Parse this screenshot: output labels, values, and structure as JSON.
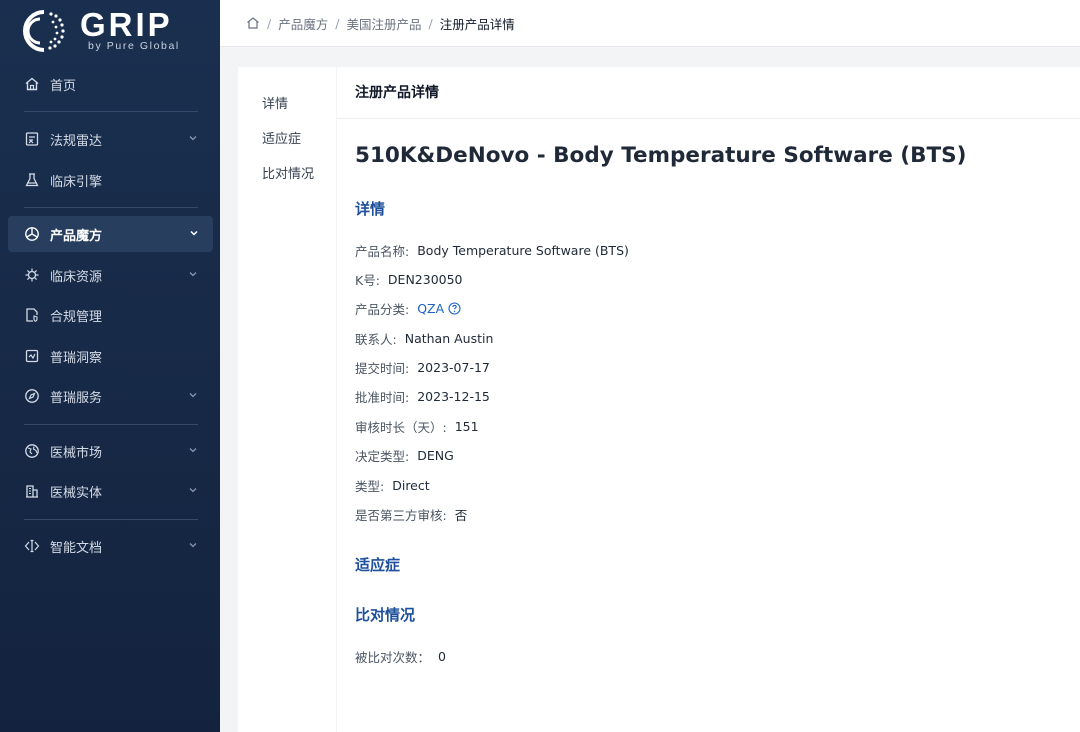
{
  "brand": {
    "name": "GRIP",
    "subtitle": "by Pure Global"
  },
  "sidebar": {
    "items": [
      {
        "label": "首页",
        "icon": "home-icon",
        "expandable": false
      },
      {
        "label": "法规雷达",
        "icon": "regulation-icon",
        "expandable": true
      },
      {
        "label": "临床引擎",
        "icon": "flask-icon",
        "expandable": false
      },
      {
        "label": "产品魔方",
        "icon": "cube-icon",
        "expandable": true,
        "active": true
      },
      {
        "label": "临床资源",
        "icon": "virus-icon",
        "expandable": true
      },
      {
        "label": "合规管理",
        "icon": "document-shield-icon",
        "expandable": false
      },
      {
        "label": "普瑞洞察",
        "icon": "insight-icon",
        "expandable": false
      },
      {
        "label": "普瑞服务",
        "icon": "compass-icon",
        "expandable": true
      },
      {
        "label": "医械市场",
        "icon": "globe-icon",
        "expandable": true
      },
      {
        "label": "医械实体",
        "icon": "building-icon",
        "expandable": true
      },
      {
        "label": "智能文档",
        "icon": "code-doc-icon",
        "expandable": true
      }
    ]
  },
  "breadcrumb": {
    "items": [
      "产品魔方",
      "美国注册产品"
    ],
    "current": "注册产品详情"
  },
  "anchors": [
    "详情",
    "适应症",
    "比对情况"
  ],
  "main": {
    "header_title": "注册产品详情",
    "product_title": "510K&DeNovo - Body Temperature Software (BTS)",
    "section_detail": "详情",
    "fields": [
      {
        "label": "产品名称:",
        "value": "Body Temperature Software (BTS)"
      },
      {
        "label": "K号:",
        "value": "DEN230050"
      },
      {
        "label": "产品分类:",
        "value": "QZA",
        "link": true
      },
      {
        "label": "联系人:",
        "value": "Nathan Austin"
      },
      {
        "label": "提交时间:",
        "value": "2023-07-17"
      },
      {
        "label": "批准时间:",
        "value": "2023-12-15"
      },
      {
        "label": "审核时长（天）:",
        "value": "151"
      },
      {
        "label": "决定类型:",
        "value": "DENG"
      },
      {
        "label": "类型:",
        "value": "Direct"
      },
      {
        "label": "是否第三方审核:",
        "value": "否"
      }
    ],
    "section_indication": "适应症",
    "section_compare": "比对情况",
    "compare_field": {
      "label": "被比对次数：",
      "value": "0"
    }
  },
  "colors": {
    "sidebar_bg": "#1a2f4f",
    "accent_blue": "#1d4f9c",
    "link_blue": "#1d63c7"
  }
}
